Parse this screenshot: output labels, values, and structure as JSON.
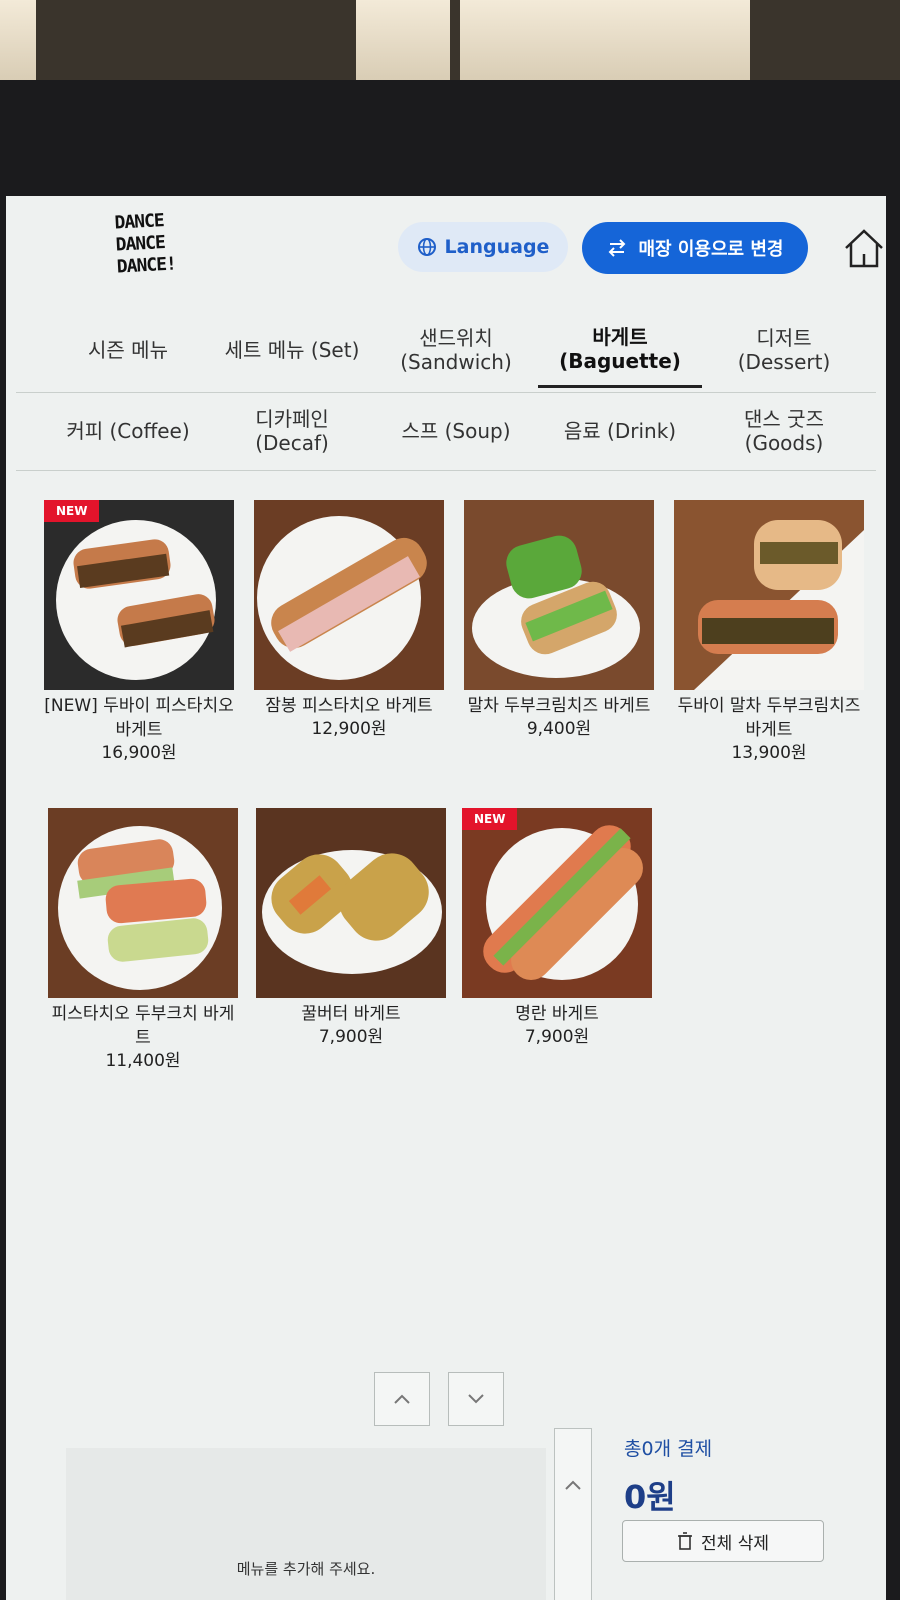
{
  "brand": {
    "logo_lines": [
      "DANCE",
      "DANCE",
      "DANCE!"
    ]
  },
  "header": {
    "language_label": "Language",
    "change_label": "매장 이용으로 변경"
  },
  "tabs_row1": [
    {
      "label": "시즌 메뉴",
      "sub": ""
    },
    {
      "label": "세트 메뉴 (Set)",
      "sub": ""
    },
    {
      "label": "샌드위치",
      "sub": "(Sandwich)"
    },
    {
      "label": "바게트",
      "sub": "(Baguette)"
    },
    {
      "label": "디저트",
      "sub": "(Dessert)"
    }
  ],
  "tabs_row2": [
    {
      "label": "커피 (Coffee)",
      "sub": ""
    },
    {
      "label": "디카페인",
      "sub": "(Decaf)"
    },
    {
      "label": "스프 (Soup)",
      "sub": ""
    },
    {
      "label": "음료 (Drink)",
      "sub": ""
    },
    {
      "label": "댄스 굿즈",
      "sub": "(Goods)"
    }
  ],
  "active_tab": "바게트 (Baguette)",
  "products": [
    {
      "name": "[NEW] 두바이 피스타치오 바게트",
      "price": "16,900원",
      "badge": "NEW"
    },
    {
      "name": "잠봉 피스타치오 바게트",
      "price": "12,900원",
      "badge": ""
    },
    {
      "name": "말차 두부크림치즈 바게트",
      "price": "9,400원",
      "badge": ""
    },
    {
      "name": "두바이 말차 두부크림치즈 바게트",
      "price": "13,900원",
      "badge": ""
    },
    {
      "name": "피스타치오 두부크치 바게트",
      "price": "11,400원",
      "badge": ""
    },
    {
      "name": "꿀버터 바게트",
      "price": "7,900원",
      "badge": ""
    },
    {
      "name": "명란 바게트",
      "price": "7,900원",
      "badge": "NEW"
    }
  ],
  "cart": {
    "empty_message": "메뉴를 추가해 주세요.",
    "total_label": "총0개 결제",
    "total_price": "0원",
    "clear_label": "전체 삭제"
  },
  "colors": {
    "accent": "#1565d8",
    "badge": "#e3142b",
    "lang_bg": "#dfe9f6"
  },
  "icons": {
    "language": "globe-icon",
    "change": "swap-arrows-icon",
    "home": "home-icon",
    "up": "chevron-up-icon",
    "down": "chevron-down-icon",
    "trash": "trash-icon"
  }
}
